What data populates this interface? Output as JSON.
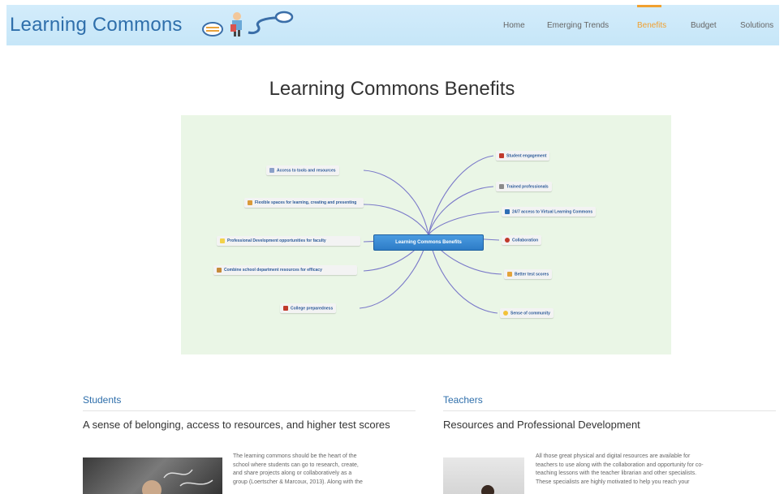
{
  "header": {
    "brand": "Learning Commons",
    "nav": [
      {
        "label": "Home"
      },
      {
        "label": "Emerging Trends"
      },
      {
        "label": "Benefits",
        "active": true
      },
      {
        "label": "Budget"
      },
      {
        "label": "Solutions"
      }
    ],
    "accent_color": "#f0a030",
    "header_bg": "#cfeafa"
  },
  "page": {
    "title": "Learning Commons Benefits"
  },
  "mindmap": {
    "center": "Learning Commons Benefits",
    "left_nodes": [
      {
        "label": "Access to tools and resources",
        "icon": "tools-icon"
      },
      {
        "label": "Flexible spaces for learning, creating and presenting",
        "icon": "spaces-icon"
      },
      {
        "label": "Professional Development opportunities for faculty",
        "icon": "lightbulb-icon"
      },
      {
        "label": "Combine school department resources for efficacy",
        "icon": "resources-icon"
      },
      {
        "label": "College preparedness",
        "icon": "book-icon"
      }
    ],
    "right_nodes": [
      {
        "label": "Student engagement",
        "icon": "student-icon"
      },
      {
        "label": "Trained professionals",
        "icon": "professional-icon"
      },
      {
        "label": "24/7 access to Virtual Learning Commons",
        "icon": "computer-icon"
      },
      {
        "label": "Collaboration",
        "icon": "collaboration-icon"
      },
      {
        "label": "Better test scores",
        "icon": "chart-icon"
      },
      {
        "label": "Sense of community",
        "icon": "smiley-icon"
      }
    ]
  },
  "sections": {
    "students": {
      "heading": "Students",
      "subheading": "A sense of belonging, access to resources, and higher test scores",
      "lines": [
        "The learning commons should be the heart of the",
        "school where students can go to research, create,",
        "and share projects along or collaboratively as a",
        "group (Loertscher & Marcoux, 2013). Along with the"
      ]
    },
    "teachers": {
      "heading": "Teachers",
      "subheading": "Resources and Professional Development",
      "lines": [
        "All those great physical and digital resources are available for",
        "teachers to use along with the collaboration and opportunity for co-",
        "teaching lessons with the teacher librarian and other specialists.",
        "These specialists are highly motivated to help you reach your"
      ]
    }
  }
}
